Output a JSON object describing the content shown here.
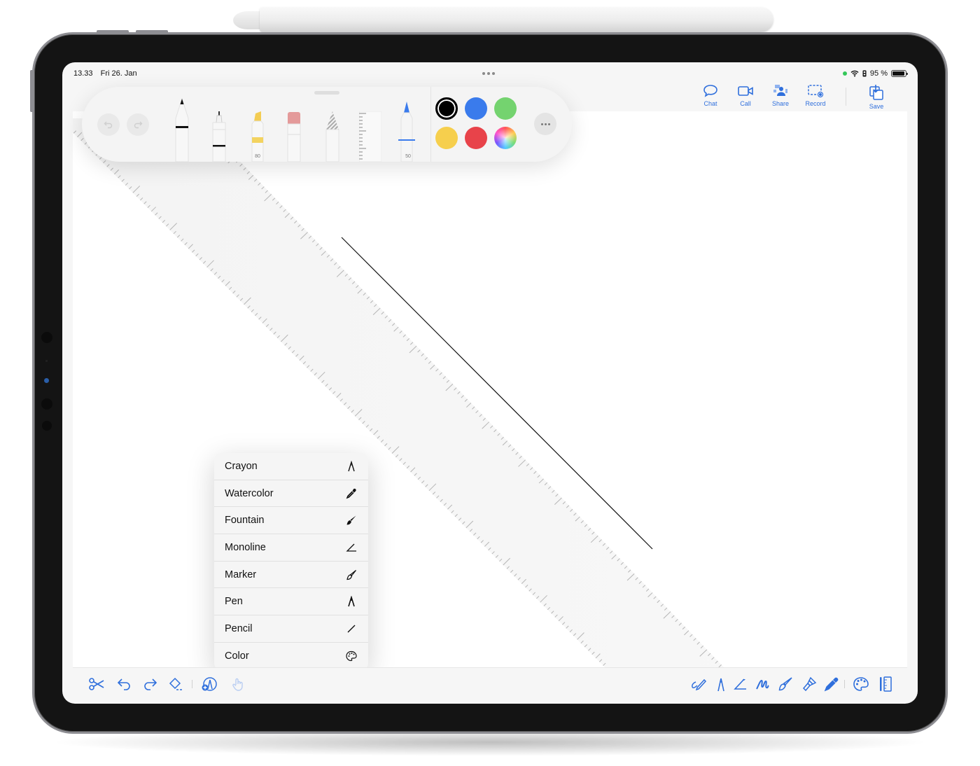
{
  "status_bar": {
    "time": "13.33",
    "date": "Fri 26. Jan",
    "battery_text": "95 %",
    "battery_level": 0.95
  },
  "actions": [
    {
      "id": "chat",
      "label": "Chat",
      "icon": "chat-bubble-icon"
    },
    {
      "id": "call",
      "label": "Call",
      "icon": "video-camera-icon"
    },
    {
      "id": "share",
      "label": "Share",
      "icon": "share-people-icon"
    },
    {
      "id": "record",
      "label": "Record",
      "icon": "record-screen-icon"
    },
    {
      "id": "save",
      "label": "Save",
      "icon": "save-download-icon"
    }
  ],
  "palette": {
    "tools": [
      {
        "id": "pen",
        "name": "Pen"
      },
      {
        "id": "fineliner",
        "name": "Fineliner"
      },
      {
        "id": "highlighter",
        "name": "Highlighter",
        "width_label": "80"
      },
      {
        "id": "eraser",
        "name": "Eraser"
      },
      {
        "id": "pencil",
        "name": "Pencil"
      },
      {
        "id": "ruler",
        "name": "Ruler"
      },
      {
        "id": "blue-pen",
        "name": "Blue pen",
        "width_label": "50"
      }
    ],
    "colors": [
      {
        "name": "black",
        "hex": "#000000",
        "selected": true
      },
      {
        "name": "blue",
        "hex": "#3a7bec",
        "selected": false
      },
      {
        "name": "green",
        "hex": "#74d36f",
        "selected": false
      },
      {
        "name": "yellow",
        "hex": "#f6cf4d",
        "selected": false
      },
      {
        "name": "red",
        "hex": "#e8434a",
        "selected": false
      },
      {
        "name": "multicolor",
        "hex": "conic",
        "selected": false
      }
    ]
  },
  "menu": {
    "items": [
      {
        "label": "Crayon",
        "icon": "crayon-icon"
      },
      {
        "label": "Watercolor",
        "icon": "eyedropper-icon"
      },
      {
        "label": "Fountain",
        "icon": "paintbrush-filled-icon"
      },
      {
        "label": "Monoline",
        "icon": "monoline-angle-icon"
      },
      {
        "label": "Marker",
        "icon": "paintbrush-outline-icon"
      },
      {
        "label": "Pen",
        "icon": "pen-nib-icon"
      },
      {
        "label": "Pencil",
        "icon": "pencil-line-icon"
      },
      {
        "label": "Color",
        "icon": "palette-icon"
      }
    ]
  },
  "bottom_toolbar": {
    "left": [
      "scissors-icon",
      "undo-icon",
      "redo-icon",
      "eraser-icon",
      "add-brush-icon",
      "touch-draw-icon"
    ],
    "right": [
      "scribble-pen-icon",
      "pen-nib-icon",
      "monoline-icon",
      "signature-icon",
      "paintbrush-icon",
      "broad-brush-icon",
      "eyedropper-icon",
      "palette-icon",
      "ruler-icon"
    ]
  },
  "theme": {
    "accent": "#2f6fdc",
    "bezel": "#141414",
    "menu_bg": "#f5f5f5"
  }
}
